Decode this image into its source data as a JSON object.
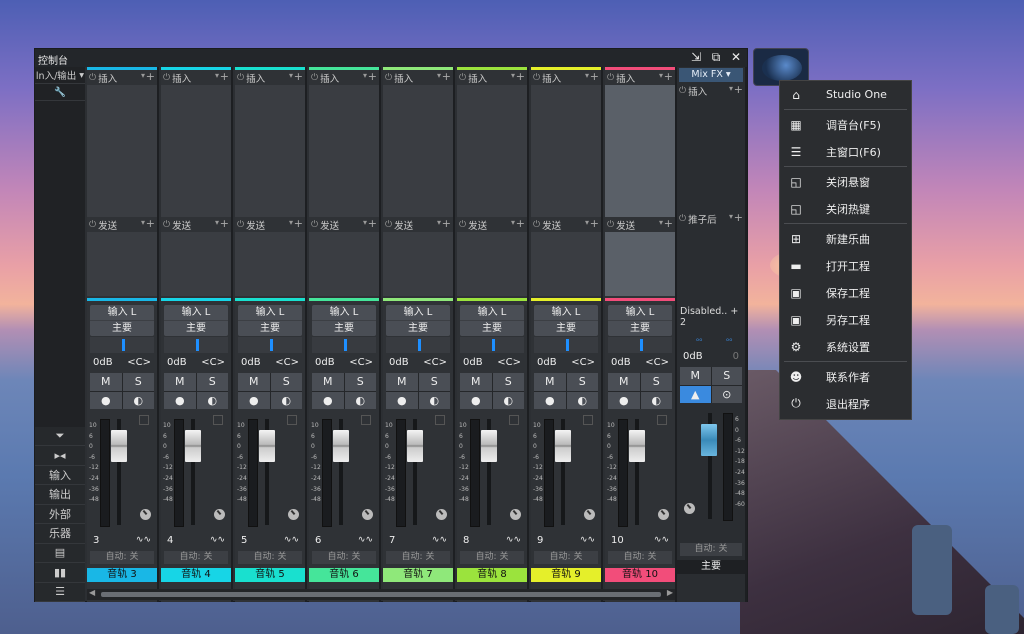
{
  "window": {
    "title": "控制台"
  },
  "left_panel": {
    "top_label": "ln入/输出",
    "bottom": [
      "输入",
      "输出",
      "外部",
      "乐器"
    ]
  },
  "slot_labels": {
    "insert": "插入",
    "send": "发送"
  },
  "io": {
    "input": "输入 L",
    "output": "主要"
  },
  "volume": "0dB",
  "pan": "<C>",
  "mute": "M",
  "solo": "S",
  "auto": "自动: 关",
  "channels": [
    {
      "num": "3",
      "name": "音轨 3",
      "color": "#19b7e6"
    },
    {
      "num": "4",
      "name": "音轨 4",
      "color": "#17d5e6"
    },
    {
      "num": "5",
      "name": "音轨 5",
      "color": "#19e0cf"
    },
    {
      "num": "6",
      "name": "音轨 6",
      "color": "#45e59a"
    },
    {
      "num": "7",
      "name": "音轨 7",
      "color": "#8fe87a"
    },
    {
      "num": "8",
      "name": "音轨 8",
      "color": "#9be33d"
    },
    {
      "num": "9",
      "name": "音轨 9",
      "color": "#e5ef2a"
    },
    {
      "num": "10",
      "name": "音轨 10",
      "color": "#f24d7a"
    }
  ],
  "fx_channel": {
    "header": "Mix FX",
    "post": "推子后",
    "disabled": "Disabled.. + 2",
    "vol": "0dB",
    "vol2": "0",
    "name": "主要"
  },
  "scale": [
    "10",
    "6",
    "0",
    "-6",
    "-12",
    "-24",
    "-36",
    "-48"
  ],
  "scale_fx": [
    "6",
    "0",
    "-6",
    "-12",
    "-18",
    "-24",
    "-36",
    "-48",
    "-60"
  ],
  "menu": {
    "app": "Studio One",
    "items": [
      "调音台(F5)",
      "主窗口(F6)",
      "关闭悬窗",
      "关闭热键",
      "新建乐曲",
      "打开工程",
      "保存工程",
      "另存工程",
      "系统设置",
      "联系作者",
      "退出程序"
    ]
  }
}
